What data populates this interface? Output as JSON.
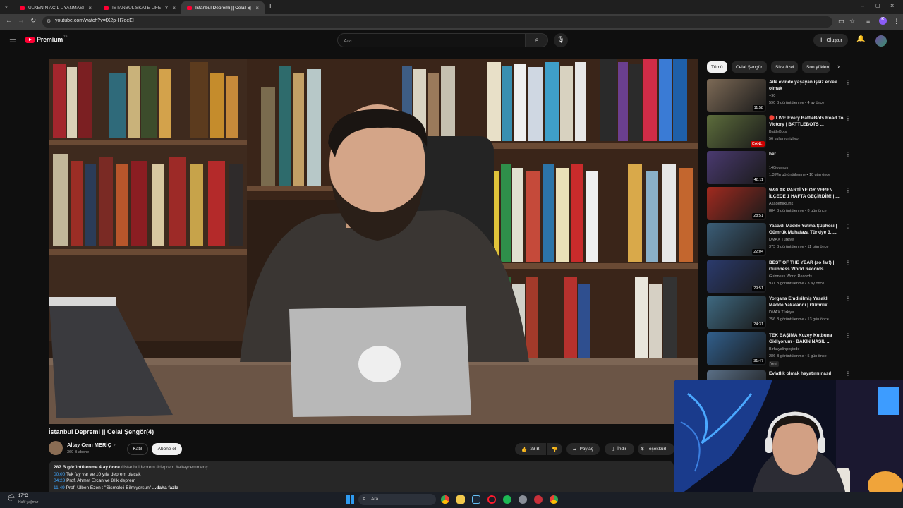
{
  "browser": {
    "tabs": [
      {
        "title": "ÜLKENİN ACİL UYANMASI GEREK"
      },
      {
        "title": "ISTANBUL SKATE LIFE - YouTube"
      },
      {
        "title": "İstanbul Depremi || Celal Şengör"
      }
    ],
    "url": "youtube.com/watch?v=fX2p-H7eeEI"
  },
  "header": {
    "logo_text": "Premium",
    "logo_region": "TR",
    "search_placeholder": "Ara",
    "create_label": "Oluştur"
  },
  "video": {
    "title": "İstanbul Depremi || Celal Şengör(4)",
    "channel": "Altay Cem MERİÇ",
    "subscribers": "360 B abone",
    "join_label": "Katıl",
    "subscribe_label": "Abone ol",
    "likes": "23 B",
    "share_label": "Paylaş",
    "download_label": "İndir",
    "thanks_label": "Teşekkürl"
  },
  "description": {
    "stats": "287 B görüntülenme  4 ay önce",
    "hashtags": "#istanbuldeprem #deprem #altaycemmeriç",
    "chapters": [
      {
        "time": "00:00",
        "text": "Tek fay var ve 10 yıla deprem olacak"
      },
      {
        "time": "04:23",
        "text": "Prof. Ahmet Ercan ve 8'lik deprem"
      },
      {
        "time": "11:49",
        "text": "Prof. Ülben Ezen : \"Sismoloji Bilmiyorsun\""
      }
    ],
    "more_label": "...daha fazla"
  },
  "sidebar": {
    "chips": [
      "Tümü",
      "Celal Şengör",
      "Size özel",
      "Son yüklen"
    ],
    "recommendations": [
      {
        "title": "Aile evinde yaşayan işsiz erkek olmak",
        "channel": "+90",
        "meta": "590 B görüntülenme • 4 ay önce",
        "duration": "11:58",
        "thumb_color": "#7d6a56"
      },
      {
        "title": "🔴 LIVE Every BattleBots Road To Victory | BATTLEBOTS ...",
        "channel": "BattleBots",
        "meta": "56 kullanıcı izliyor",
        "duration": "CANLI",
        "thumb_color": "#5d6d3c"
      },
      {
        "title": "bet",
        "channel": "140journos",
        "meta": "1,3 Mn görüntülenme • 10 gün önce",
        "duration": "48:11",
        "thumb_color": "#4a3a70"
      },
      {
        "title": "%90 AK PARTİ'YE OY VEREN İLÇEDE 1 HAFTA GEÇİRDİM! | ...",
        "channel": "AkademikLink",
        "meta": "884 B görüntülenme • 8 gün önce",
        "duration": "28:51",
        "thumb_color": "#a12a1f"
      },
      {
        "title": "Yasaklı Madde Yutma Şüphesi | Gümrük Muhafaza Türkiye 3. ...",
        "channel": "DMAX Türkiye",
        "meta": "373 B görüntülenme • 11 gün önce",
        "duration": "22:04",
        "thumb_color": "#3b5e78"
      },
      {
        "title": "BEST OF THE YEAR (so far!) | Guinness World Records",
        "channel": "Guinness World Records",
        "meta": "931 B görüntülenme • 3 ay önce",
        "duration": "29:51",
        "thumb_color": "#2b3b6e"
      },
      {
        "title": "Yorgana Emdirilmiş Yasaklı Madde Yakalandı | Gümrük ...",
        "channel": "DMAX Türkiye",
        "meta": "256 B görüntülenme • 13 gün önce",
        "duration": "24:31",
        "thumb_color": "#3f6a82"
      },
      {
        "title": "TEK BAŞIMA Kuzey Kutbuna Gidiyorum - BAKIN NASIL ...",
        "channel": "Birhayalinpeşinde",
        "meta": "286 B görüntülenme • 5 gün önce",
        "duration": "31:47",
        "thumb_color": "#315f8c",
        "badge": "Yeni"
      },
      {
        "title": "Evlatlık olmak hayatımı nasıl",
        "channel": "",
        "meta": "",
        "duration": "",
        "thumb_color": "#5a6f86"
      }
    ]
  },
  "taskbar": {
    "weather_temp": "17°C",
    "weather_desc": "Hafif yağmur",
    "search_label": "Ara"
  }
}
